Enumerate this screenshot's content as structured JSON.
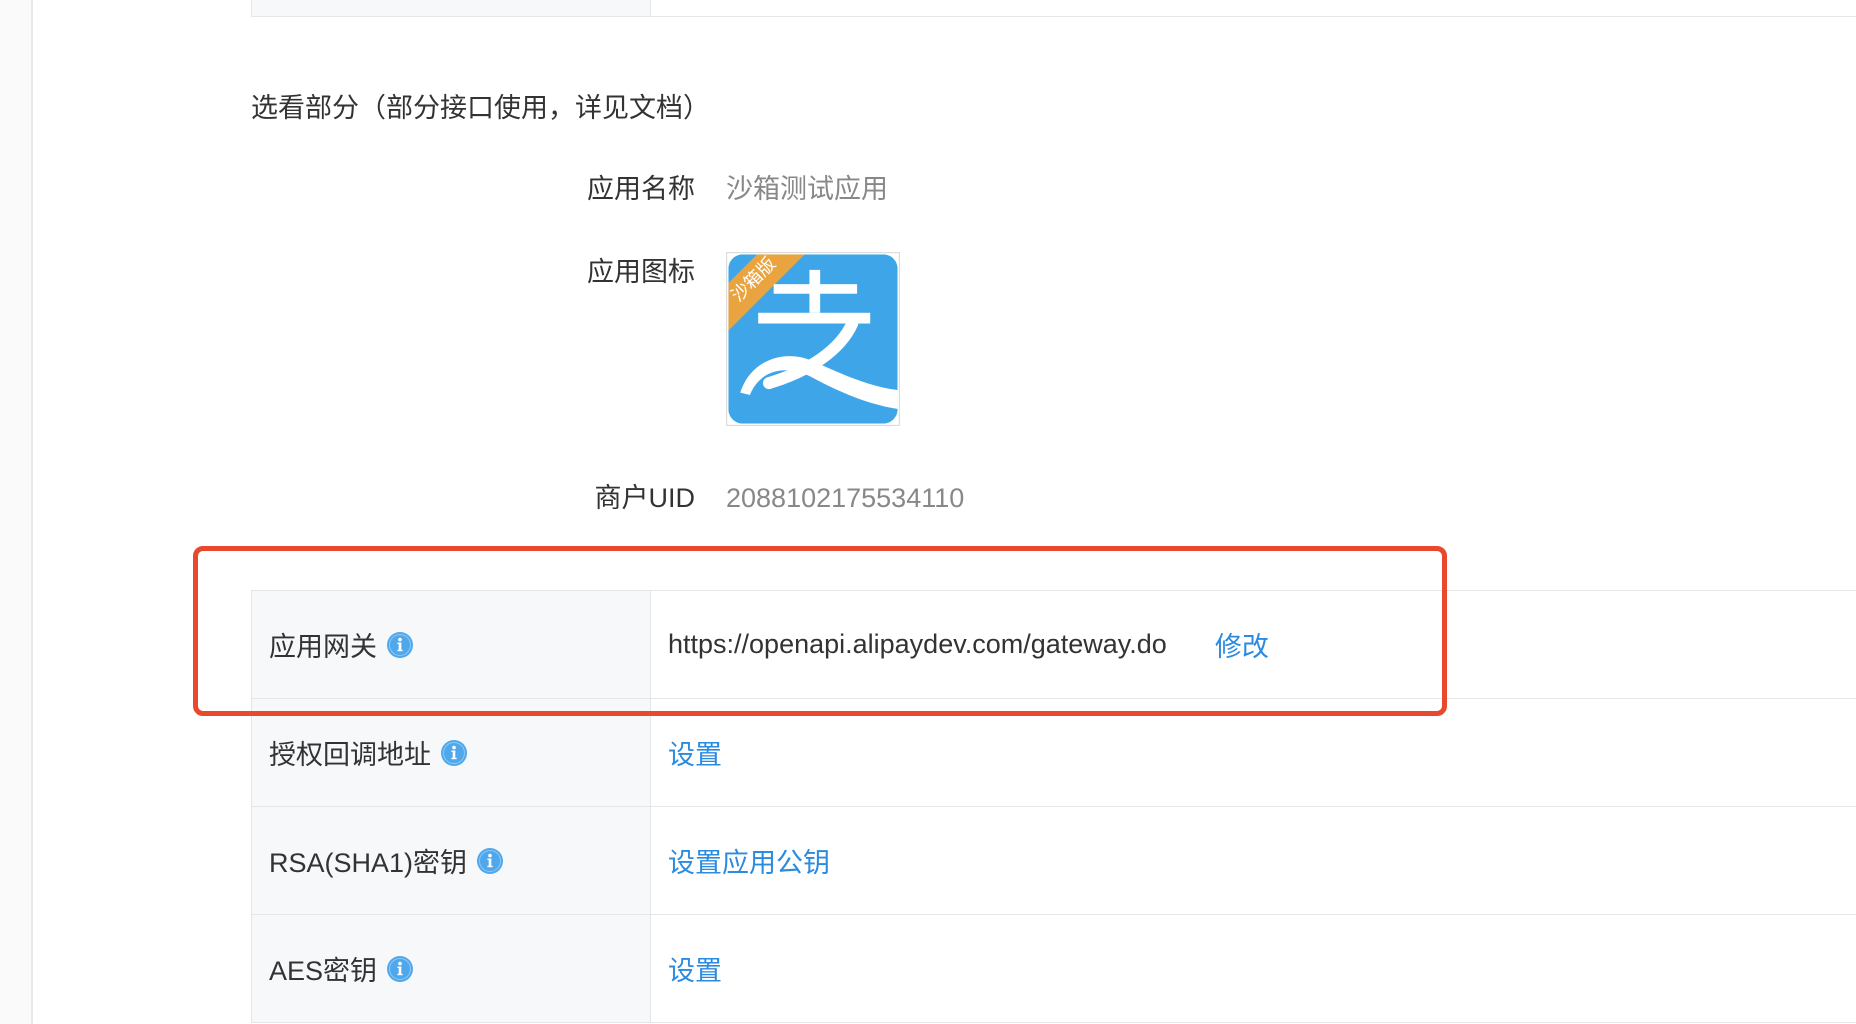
{
  "section_title": "选看部分（部分接口使用，详见文档）",
  "app_info": {
    "name_label": "应用名称",
    "name_value": "沙箱测试应用",
    "icon_label": "应用图标",
    "icon_ribbon": "沙箱版",
    "uid_label": "商户UID",
    "uid_value": "2088102175534110"
  },
  "settings_rows": [
    {
      "label": "应用网关",
      "value": "https://openapi.alipaydev.com/gateway.do",
      "action": "修改"
    },
    {
      "label": "授权回调地址",
      "action": "设置"
    },
    {
      "label": "RSA(SHA1)密钥",
      "action": "设置应用公钥"
    },
    {
      "label": "AES密钥",
      "action": "设置"
    }
  ],
  "icons": {
    "info": "info-icon",
    "app": "alipay-sandbox-app-icon"
  },
  "colors": {
    "link": "#2b8be0",
    "info_icon": "#4fa8ec",
    "highlight": "#e8482c",
    "label_bg": "#f7f8fa",
    "icon_blue": "#3ea6e8",
    "ribbon": "#eaa43f"
  }
}
